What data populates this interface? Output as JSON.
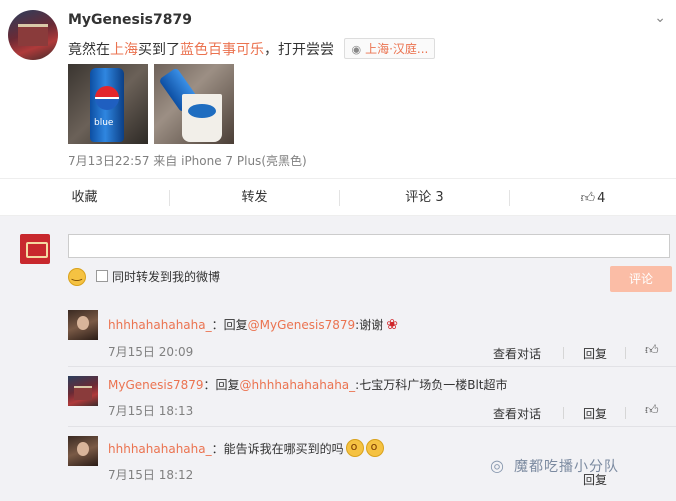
{
  "post": {
    "username": "MyGenesis7879",
    "text_part1": "竟然在",
    "text_place": "上海",
    "text_part2": "买到了",
    "text_product": "蓝色百事可乐",
    "text_part3": "，打开尝尝",
    "location": "上海·汉庭...",
    "meta": "7月13日22:57 来自 iPhone 7 Plus(亮黑色)",
    "chevron_icon": "chevron-down-icon"
  },
  "actions": {
    "favorite": "收藏",
    "repost": "转发",
    "comment": "评论 3",
    "like_count": "4"
  },
  "composer": {
    "input_value": "",
    "also_repost": "同时转发到我的微博",
    "submit": "评论"
  },
  "comments": [
    {
      "user": "hhhhahahahaha_",
      "sep": "：",
      "reply": "回复",
      "mention": "@MyGenesis7879",
      "text": ":谢谢",
      "time": "7月15日 20:09",
      "view_thread": "查看对话",
      "reply_btn": "回复"
    },
    {
      "user": "MyGenesis7879",
      "sep": "：",
      "reply": "回复",
      "mention": "@hhhhahahahaha_",
      "text": ":七宝万科广场负一楼Blt超市",
      "time": "7月15日 18:13",
      "view_thread": "查看对话",
      "reply_btn": "回复"
    },
    {
      "user": "hhhhahahahaha_",
      "sep": "：",
      "text": "能告诉我在哪买到的吗",
      "time": "7月15日 18:12",
      "reply_btn": "回复"
    }
  ],
  "watermark": "魔都吃播小分队",
  "colors": {
    "accent": "#eb7350",
    "submit_bg": "#fbbda6",
    "comment_bg": "#f2f2f5"
  }
}
